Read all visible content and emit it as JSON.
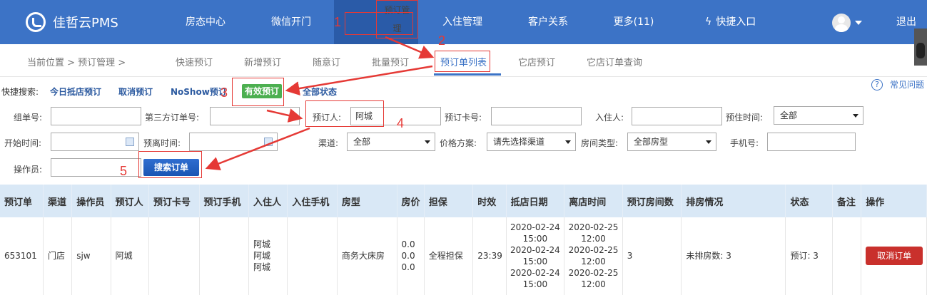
{
  "app": {
    "logo_text": "佳哲云PMS"
  },
  "topnav": {
    "items": [
      "房态中心",
      "微信开门",
      "预订管理",
      "入住管理",
      "客户关系",
      "更多(11)"
    ],
    "quick_entry": "快捷入口",
    "logout": "退出"
  },
  "subnav": {
    "breadcrumb": "当前位置 > 预订管理 >",
    "items": [
      "快速预订",
      "新增预订",
      "随意订",
      "批量预订",
      "预订单列表",
      "它店预订",
      "它店订单查询"
    ]
  },
  "quick_search": {
    "label": "快捷搜索:",
    "links": [
      "今日抵店预订",
      "取消预订",
      "NoShow预订",
      "有效预订",
      "全部状态"
    ]
  },
  "help": {
    "label": "常见问题"
  },
  "form": {
    "group_no": {
      "label": "组单号:",
      "value": ""
    },
    "third_party_no": {
      "label": "第三方订单号:",
      "value": ""
    },
    "booker": {
      "label": "预订人:",
      "value": "阿城"
    },
    "booking_card": {
      "label": "预订卡号:",
      "value": ""
    },
    "guest": {
      "label": "入住人:",
      "value": ""
    },
    "stay_time": {
      "label": "预住时间:",
      "value": "全部"
    },
    "start_time": {
      "label": "开始时间:",
      "value": ""
    },
    "departure_time": {
      "label": "预离时间:",
      "value": ""
    },
    "channel": {
      "label": "渠道:",
      "value": "全部"
    },
    "price_plan": {
      "label": "价格方案:",
      "value": "请先选择渠道"
    },
    "room_type": {
      "label": "房间类型:",
      "value": "全部房型"
    },
    "phone": {
      "label": "手机号:",
      "value": ""
    },
    "operator": {
      "label": "操作员:",
      "value": ""
    },
    "search_button": "搜索订单"
  },
  "annotations": [
    "1",
    "2",
    "3",
    "4",
    "5"
  ],
  "table": {
    "headers": [
      "预订单",
      "渠道",
      "操作员",
      "预订人",
      "预订卡号",
      "预订手机",
      "入住人",
      "入住手机",
      "房型",
      "房价",
      "担保",
      "时效",
      "抵店日期",
      "离店时间",
      "预订房间数",
      "排房情况",
      "状态",
      "备注",
      "操作"
    ],
    "rows": [
      {
        "order_no": "653101",
        "channel": "门店",
        "operator": "sjw",
        "booker": "阿城",
        "card_no": "",
        "booker_phone": "",
        "guests": [
          "阿城",
          "阿城",
          "阿城"
        ],
        "guest_phone": "",
        "room_type": "商务大床房",
        "prices": [
          "0.0",
          "0.0",
          "0.0"
        ],
        "guarantee": "全程担保",
        "validity": "23:39",
        "arrival": [
          "2020-02-24",
          "15:00",
          "2020-02-24",
          "15:00",
          "2020-02-24",
          "15:00"
        ],
        "departure": [
          "2020-02-25",
          "12:00",
          "2020-02-25",
          "12:00",
          "2020-02-25",
          "12:00"
        ],
        "room_count": "3",
        "assignment": "未排房数: 3",
        "status": "预订: 3",
        "remark": "",
        "action": "取消订单"
      }
    ]
  },
  "colors": {
    "header_blue": "#3c73c6",
    "active_nav": "#2a5ba8",
    "annotation_red": "#e53935",
    "green": "#4caf50",
    "cancel_red": "#c9302c"
  }
}
